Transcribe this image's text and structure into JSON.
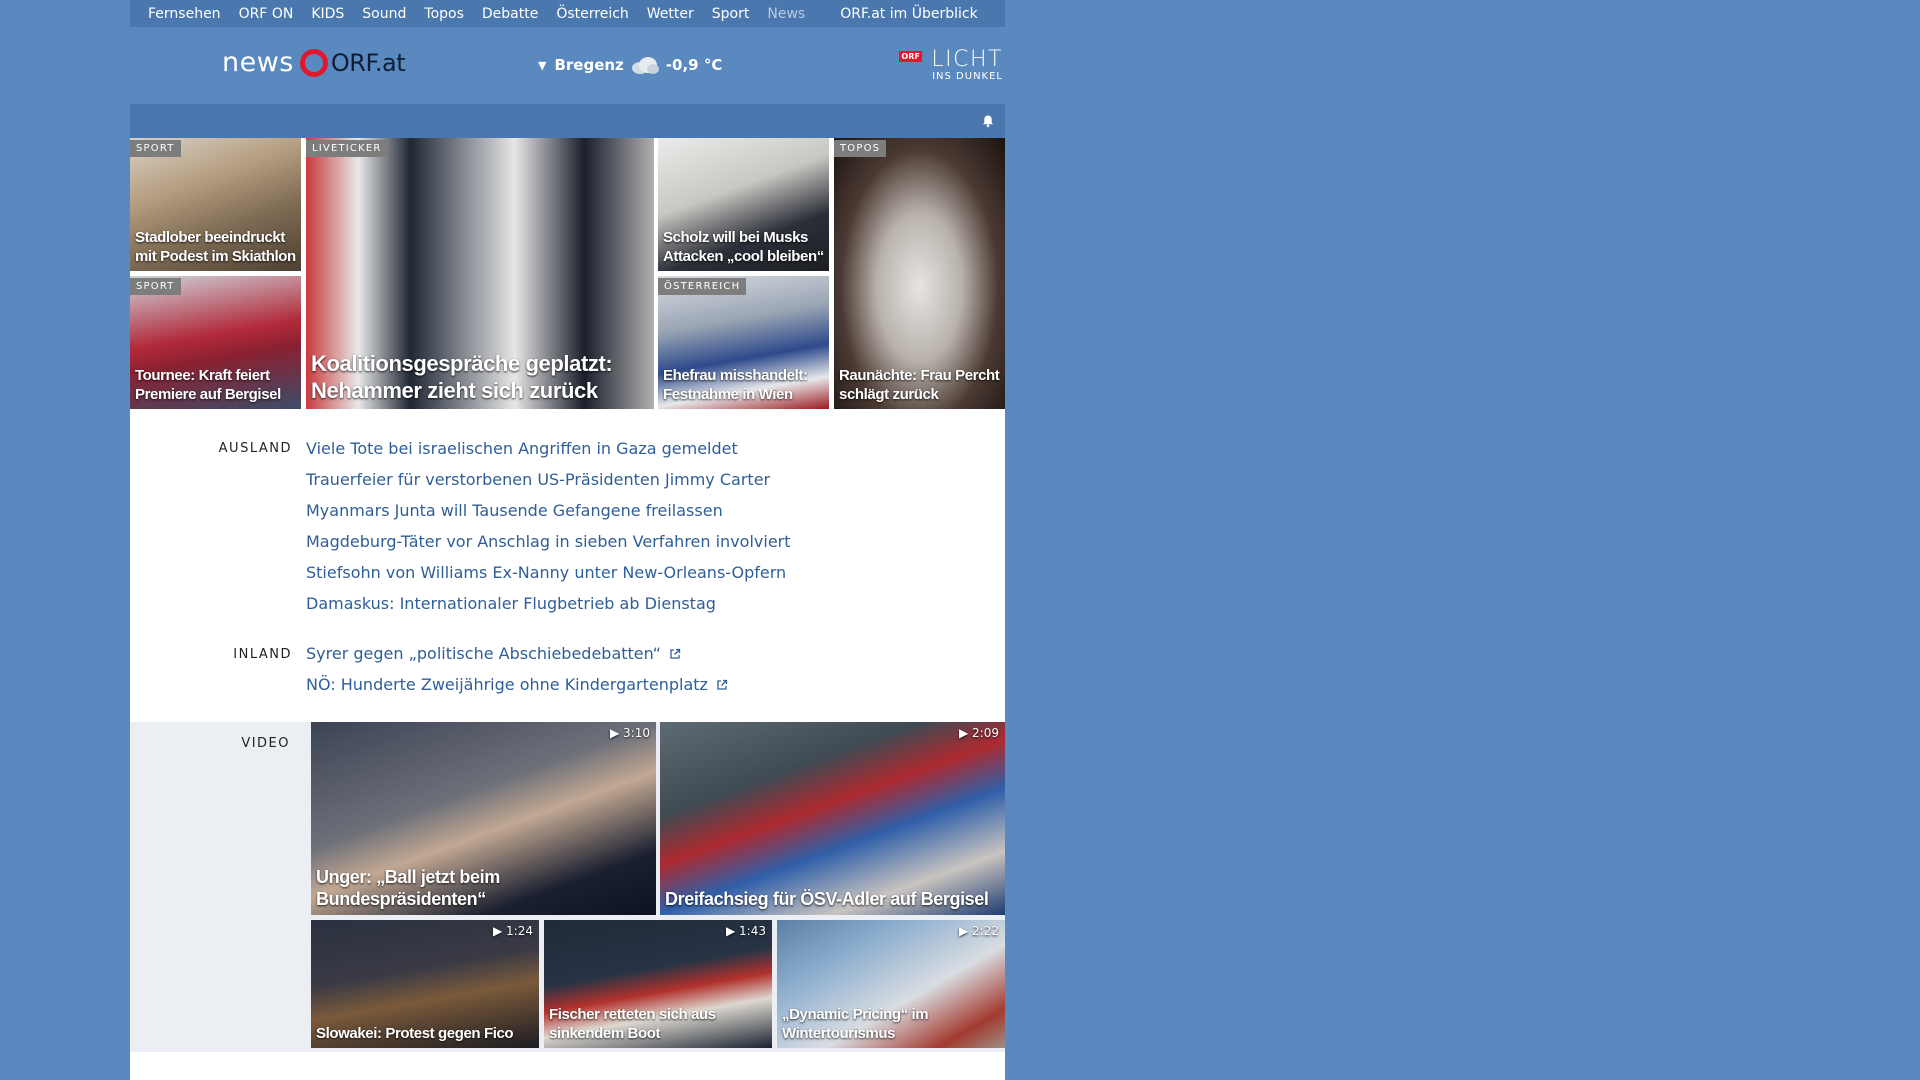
{
  "nav": {
    "items": [
      "Fernsehen",
      "ORF ON",
      "KIDS",
      "Sound",
      "Topos",
      "Debatte",
      "Österreich",
      "Wetter",
      "Sport",
      "News"
    ],
    "overview": "ORF.at im Überblick"
  },
  "header": {
    "logo_news": "news",
    "logo_orf": "ORF.at",
    "weather": {
      "location": "Bregenz",
      "temperature": "-0,9 °C",
      "icon": "cloud-icon"
    },
    "licht": {
      "badge": "ORF",
      "title": "LICHT",
      "subtitle": "INS DUNKEL"
    }
  },
  "bar": {
    "icon": "bell-icon"
  },
  "tiles": [
    {
      "label": "SPORT",
      "caption": "Stadlober beeindruckt mit Podest im Skiathlon"
    },
    {
      "label": "SPORT",
      "caption": "Tournee: Kraft feiert Premiere auf Bergisel"
    },
    {
      "label": "LIVETICKER",
      "caption": "Koalitionsgespräche geplatzt: Nehammer zieht sich zurück"
    },
    {
      "label": "",
      "caption": "Scholz will bei Musks Attacken „cool bleiben“"
    },
    {
      "label": "ÖSTERREICH",
      "caption": "Ehefrau misshandelt: Festnahme in Wien"
    },
    {
      "label": "TOPOS",
      "caption": "Raunächte: Frau Percht schlägt zurück"
    }
  ],
  "ausland": {
    "label": "AUSLAND",
    "links": [
      "Viele Tote bei israelischen Angriffen in Gaza gemeldet",
      "Trauerfeier für verstorbenen US-Präsidenten Jimmy Carter",
      "Myanmars Junta will Tausende Gefangene freilassen",
      "Magdeburg-Täter vor Anschlag in sieben Verfahren involviert",
      "Stiefsohn von Williams Ex-Nanny unter New-Orleans-Opfern",
      "Damaskus: Internationaler Flugbetrieb ab Dienstag"
    ]
  },
  "inland": {
    "label": "INLAND",
    "links": [
      "Syrer gegen „politische Abschiebedebatten“",
      "NÖ: Hunderte Zweijährige ohne Kindergartenplatz"
    ]
  },
  "video": {
    "label": "VIDEO",
    "items": [
      {
        "caption": "Unger: „Ball jetzt beim Bundespräsidenten“",
        "duration": "3:10"
      },
      {
        "caption": "Dreifachsieg für ÖSV-Adler auf Bergisel",
        "duration": "2:09"
      },
      {
        "caption": "Slowakei: Protest gegen Fico",
        "duration": "1:24"
      },
      {
        "caption": "Fischer retteten sich aus sinkendem Boot",
        "duration": "1:43"
      },
      {
        "caption": "„Dynamic Pricing“ im Wintertourismus",
        "duration": "2:22"
      }
    ]
  },
  "colors": {
    "page_bg": "#5a89c0",
    "nav_bg": "#4a78ae",
    "link": "#2f5e99",
    "orf_red": "#e0182d"
  }
}
